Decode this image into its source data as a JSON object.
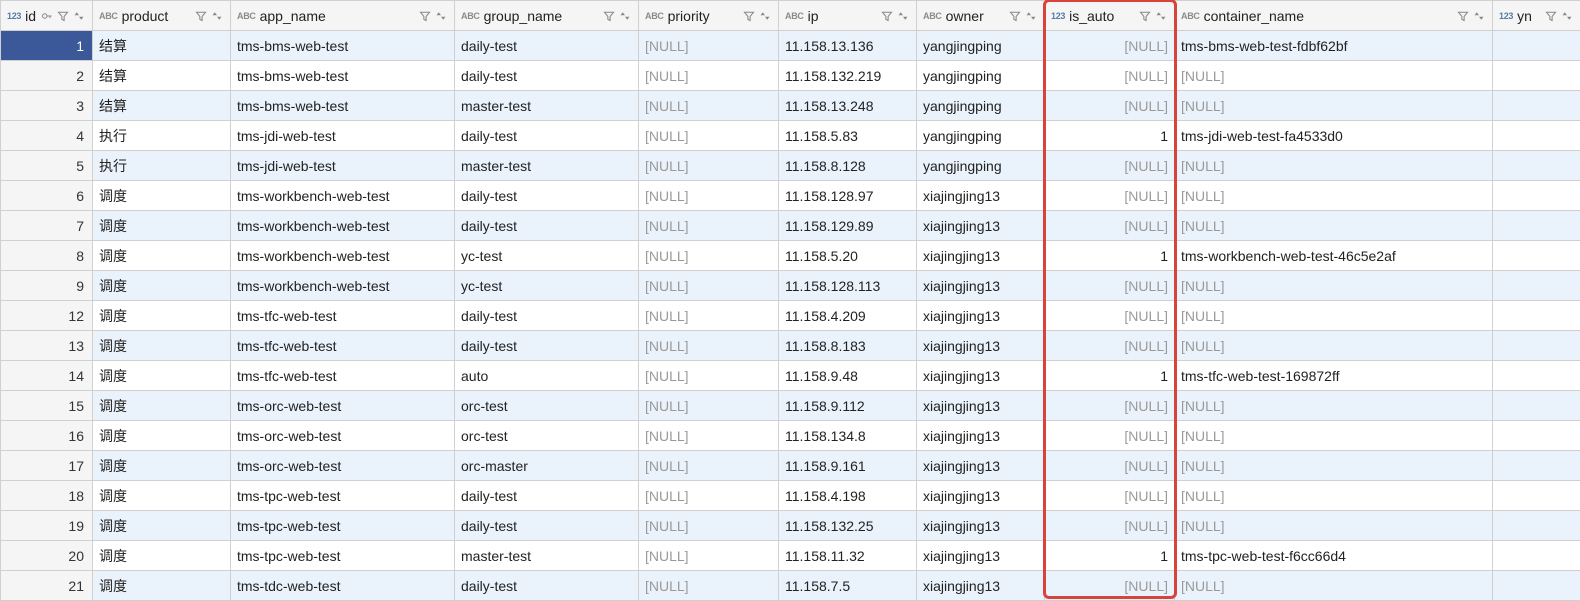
{
  "columns": [
    {
      "key": "id",
      "label": "id",
      "type": "123",
      "pk": true,
      "align": "right"
    },
    {
      "key": "product",
      "label": "product",
      "type": "ABC",
      "align": "left"
    },
    {
      "key": "app_name",
      "label": "app_name",
      "type": "ABC",
      "align": "left"
    },
    {
      "key": "group_name",
      "label": "group_name",
      "type": "ABC",
      "align": "left"
    },
    {
      "key": "priority",
      "label": "priority",
      "type": "ABC",
      "align": "left"
    },
    {
      "key": "ip",
      "label": "ip",
      "type": "ABC",
      "align": "left"
    },
    {
      "key": "owner",
      "label": "owner",
      "type": "ABC",
      "align": "left"
    },
    {
      "key": "is_auto",
      "label": "is_auto",
      "type": "123",
      "align": "right"
    },
    {
      "key": "container_name",
      "label": "container_name",
      "type": "ABC",
      "align": "left"
    },
    {
      "key": "yn",
      "label": "yn",
      "type": "123",
      "align": "right"
    }
  ],
  "rows": [
    {
      "id": "1",
      "product": "结算",
      "app_name": "tms-bms-web-test",
      "group_name": "daily-test",
      "priority": null,
      "ip": "11.158.13.136",
      "owner": "yangjingping",
      "is_auto": null,
      "container_name": "tms-bms-web-test-fdbf62bf",
      "yn": ""
    },
    {
      "id": "2",
      "product": "结算",
      "app_name": "tms-bms-web-test",
      "group_name": "daily-test",
      "priority": null,
      "ip": "11.158.132.219",
      "owner": "yangjingping",
      "is_auto": null,
      "container_name": null,
      "yn": ""
    },
    {
      "id": "3",
      "product": "结算",
      "app_name": "tms-bms-web-test",
      "group_name": "master-test",
      "priority": null,
      "ip": "11.158.13.248",
      "owner": "yangjingping",
      "is_auto": null,
      "container_name": null,
      "yn": ""
    },
    {
      "id": "4",
      "product": "执行",
      "app_name": "tms-jdi-web-test",
      "group_name": "daily-test",
      "priority": null,
      "ip": "11.158.5.83",
      "owner": "yangjingping",
      "is_auto": "1",
      "container_name": "tms-jdi-web-test-fa4533d0",
      "yn": ""
    },
    {
      "id": "5",
      "product": "执行",
      "app_name": "tms-jdi-web-test",
      "group_name": "master-test",
      "priority": null,
      "ip": "11.158.8.128",
      "owner": "yangjingping",
      "is_auto": null,
      "container_name": null,
      "yn": ""
    },
    {
      "id": "6",
      "product": "调度",
      "app_name": "tms-workbench-web-test",
      "group_name": "daily-test",
      "priority": null,
      "ip": "11.158.128.97",
      "owner": "xiajingjing13",
      "is_auto": null,
      "container_name": null,
      "yn": ""
    },
    {
      "id": "7",
      "product": "调度",
      "app_name": "tms-workbench-web-test",
      "group_name": "daily-test",
      "priority": null,
      "ip": "11.158.129.89",
      "owner": "xiajingjing13",
      "is_auto": null,
      "container_name": null,
      "yn": ""
    },
    {
      "id": "8",
      "product": "调度",
      "app_name": "tms-workbench-web-test",
      "group_name": "yc-test",
      "priority": null,
      "ip": "11.158.5.20",
      "owner": "xiajingjing13",
      "is_auto": "1",
      "container_name": "tms-workbench-web-test-46c5e2af",
      "yn": ""
    },
    {
      "id": "9",
      "product": "调度",
      "app_name": "tms-workbench-web-test",
      "group_name": "yc-test",
      "priority": null,
      "ip": "11.158.128.113",
      "owner": "xiajingjing13",
      "is_auto": null,
      "container_name": null,
      "yn": ""
    },
    {
      "id": "12",
      "product": "调度",
      "app_name": "tms-tfc-web-test",
      "group_name": "daily-test",
      "priority": null,
      "ip": "11.158.4.209",
      "owner": "xiajingjing13",
      "is_auto": null,
      "container_name": null,
      "yn": ""
    },
    {
      "id": "13",
      "product": "调度",
      "app_name": "tms-tfc-web-test",
      "group_name": "daily-test",
      "priority": null,
      "ip": "11.158.8.183",
      "owner": "xiajingjing13",
      "is_auto": null,
      "container_name": null,
      "yn": ""
    },
    {
      "id": "14",
      "product": "调度",
      "app_name": "tms-tfc-web-test",
      "group_name": "auto",
      "priority": null,
      "ip": "11.158.9.48",
      "owner": "xiajingjing13",
      "is_auto": "1",
      "container_name": "tms-tfc-web-test-169872ff",
      "yn": ""
    },
    {
      "id": "15",
      "product": "调度",
      "app_name": "tms-orc-web-test",
      "group_name": "orc-test",
      "priority": null,
      "ip": "11.158.9.112",
      "owner": "xiajingjing13",
      "is_auto": null,
      "container_name": null,
      "yn": ""
    },
    {
      "id": "16",
      "product": "调度",
      "app_name": "tms-orc-web-test",
      "group_name": "orc-test",
      "priority": null,
      "ip": "11.158.134.8",
      "owner": "xiajingjing13",
      "is_auto": null,
      "container_name": null,
      "yn": ""
    },
    {
      "id": "17",
      "product": "调度",
      "app_name": "tms-orc-web-test",
      "group_name": "orc-master",
      "priority": null,
      "ip": "11.158.9.161",
      "owner": "xiajingjing13",
      "is_auto": null,
      "container_name": null,
      "yn": ""
    },
    {
      "id": "18",
      "product": "调度",
      "app_name": "tms-tpc-web-test",
      "group_name": "daily-test",
      "priority": null,
      "ip": "11.158.4.198",
      "owner": "xiajingjing13",
      "is_auto": null,
      "container_name": null,
      "yn": ""
    },
    {
      "id": "19",
      "product": "调度",
      "app_name": "tms-tpc-web-test",
      "group_name": "daily-test",
      "priority": null,
      "ip": "11.158.132.25",
      "owner": "xiajingjing13",
      "is_auto": null,
      "container_name": null,
      "yn": ""
    },
    {
      "id": "20",
      "product": "调度",
      "app_name": "tms-tpc-web-test",
      "group_name": "master-test",
      "priority": null,
      "ip": "11.158.11.32",
      "owner": "xiajingjing13",
      "is_auto": "1",
      "container_name": "tms-tpc-web-test-f6cc66d4",
      "yn": ""
    },
    {
      "id": "21",
      "product": "调度",
      "app_name": "tms-tdc-web-test",
      "group_name": "daily-test",
      "priority": null,
      "ip": "11.158.7.5",
      "owner": "xiajingjing13",
      "is_auto": null,
      "container_name": null,
      "yn": ""
    }
  ],
  "null_label": "[NULL]",
  "selected_row_index": 0,
  "highlight_column": "is_auto"
}
